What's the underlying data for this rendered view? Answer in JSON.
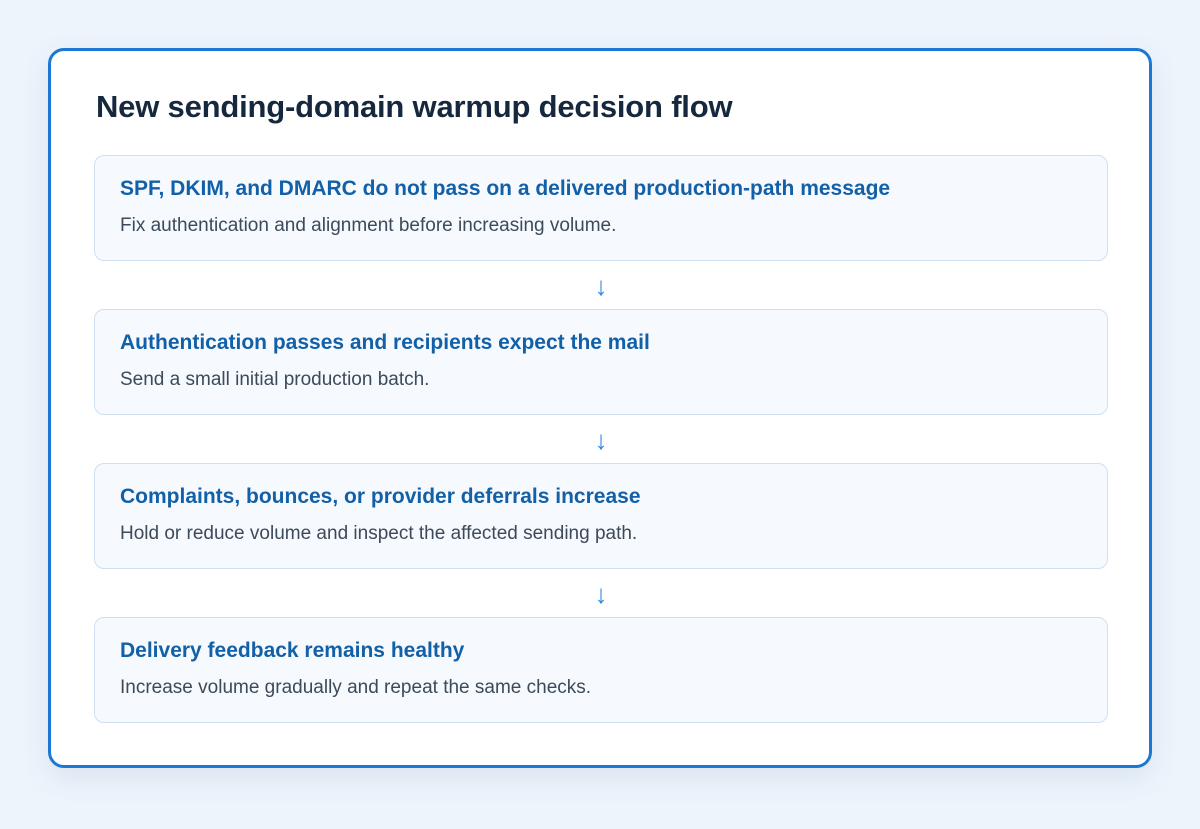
{
  "diagram": {
    "title": "New sending-domain warmup decision flow",
    "steps": [
      {
        "heading": "SPF, DKIM, and DMARC do not pass on a delivered production-path message",
        "description": "Fix authentication and alignment before increasing volume."
      },
      {
        "heading": "Authentication passes and recipients expect the mail",
        "description": "Send a small initial production batch."
      },
      {
        "heading": "Complaints, bounces, or provider deferrals increase",
        "description": "Hold or reduce volume and inspect the affected sending path."
      },
      {
        "heading": "Delivery feedback remains healthy",
        "description": "Increase volume gradually and repeat the same checks."
      }
    ],
    "connector_glyph": "↓",
    "colors": {
      "frame_border": "#1b78d4",
      "heading_text": "#1260a8",
      "title_text": "#16283e",
      "arrow": "#2f8ae0",
      "step_background": "#f6f9fd"
    }
  }
}
